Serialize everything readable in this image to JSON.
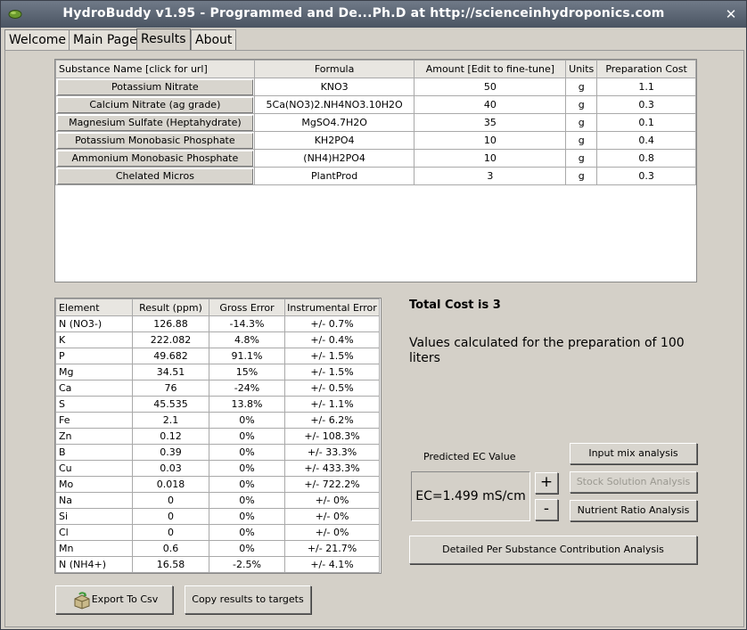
{
  "window": {
    "title": "HydroBuddy v1.95 - Programmed and De...Ph.D at http://scienceinhydroponics.com",
    "close_label": "✕"
  },
  "tabs": [
    {
      "label": "Welcome",
      "active": false
    },
    {
      "label": "Main Page",
      "active": false
    },
    {
      "label": "Results",
      "active": true
    },
    {
      "label": "About",
      "active": false
    }
  ],
  "substances": {
    "headers": [
      "Substance Name [click for url]",
      "Formula",
      "Amount [Edit to fine-tune]",
      "Units",
      "Preparation Cost"
    ],
    "rows": [
      {
        "name": "Potassium Nitrate",
        "formula": "KNO3",
        "amount": "50",
        "units": "g",
        "cost": "1.1"
      },
      {
        "name": "Calcium Nitrate (ag grade)",
        "formula": "5Ca(NO3)2.NH4NO3.10H2O",
        "amount": "40",
        "units": "g",
        "cost": "0.3"
      },
      {
        "name": "Magnesium Sulfate (Heptahydrate)",
        "formula": "MgSO4.7H2O",
        "amount": "35",
        "units": "g",
        "cost": "0.1"
      },
      {
        "name": "Potassium Monobasic Phosphate",
        "formula": "KH2PO4",
        "amount": "10",
        "units": "g",
        "cost": "0.4"
      },
      {
        "name": "Ammonium Monobasic Phosphate",
        "formula": "(NH4)H2PO4",
        "amount": "10",
        "units": "g",
        "cost": "0.8"
      },
      {
        "name": "Chelated Micros",
        "formula": "PlantProd",
        "amount": "3",
        "units": "g",
        "cost": "0.3"
      }
    ]
  },
  "elements": {
    "headers": [
      "Element",
      "Result (ppm)",
      "Gross Error",
      "Instrumental Error"
    ],
    "rows": [
      {
        "element": "N (NO3-)",
        "result": "126.88",
        "gross": "-14.3%",
        "instr": "+/- 0.7%"
      },
      {
        "element": "K",
        "result": "222.082",
        "gross": "4.8%",
        "instr": "+/- 0.4%"
      },
      {
        "element": "P",
        "result": "49.682",
        "gross": "91.1%",
        "instr": "+/- 1.5%"
      },
      {
        "element": "Mg",
        "result": "34.51",
        "gross": "15%",
        "instr": "+/- 1.5%"
      },
      {
        "element": "Ca",
        "result": "76",
        "gross": "-24%",
        "instr": "+/- 0.5%"
      },
      {
        "element": "S",
        "result": "45.535",
        "gross": "13.8%",
        "instr": "+/- 1.1%"
      },
      {
        "element": "Fe",
        "result": "2.1",
        "gross": "0%",
        "instr": "+/- 6.2%"
      },
      {
        "element": "Zn",
        "result": "0.12",
        "gross": "0%",
        "instr": "+/- 108.3%"
      },
      {
        "element": "B",
        "result": "0.39",
        "gross": "0%",
        "instr": "+/- 33.3%"
      },
      {
        "element": "Cu",
        "result": "0.03",
        "gross": "0%",
        "instr": "+/- 433.3%"
      },
      {
        "element": "Mo",
        "result": "0.018",
        "gross": "0%",
        "instr": "+/- 722.2%"
      },
      {
        "element": "Na",
        "result": "0",
        "gross": "0%",
        "instr": "+/- 0%"
      },
      {
        "element": "Si",
        "result": "0",
        "gross": "0%",
        "instr": "+/- 0%"
      },
      {
        "element": "Cl",
        "result": "0",
        "gross": "0%",
        "instr": "+/- 0%"
      },
      {
        "element": "Mn",
        "result": "0.6",
        "gross": "0%",
        "instr": "+/- 21.7%"
      },
      {
        "element": "N (NH4+)",
        "result": "16.58",
        "gross": "-2.5%",
        "instr": "+/- 4.1%"
      }
    ]
  },
  "summary": {
    "total_cost": "Total Cost is 3",
    "values_note": "Values calculated for the preparation of 100 liters"
  },
  "ec": {
    "label": "Predicted EC Value",
    "value": "EC=1.499 mS/cm",
    "plus": "+",
    "minus": "-"
  },
  "buttons": {
    "input_mix": "Input mix analysis",
    "stock_solution": "Stock Solution Analysis",
    "nutrient_ratio": "Nutrient Ratio Analysis",
    "detailed": "Detailed Per Substance Contribution Analysis",
    "export_csv": "Export To Csv",
    "copy_results": "Copy results to targets"
  },
  "icons": {
    "app": "leaf-app-icon",
    "export": "recycle-box-icon"
  }
}
